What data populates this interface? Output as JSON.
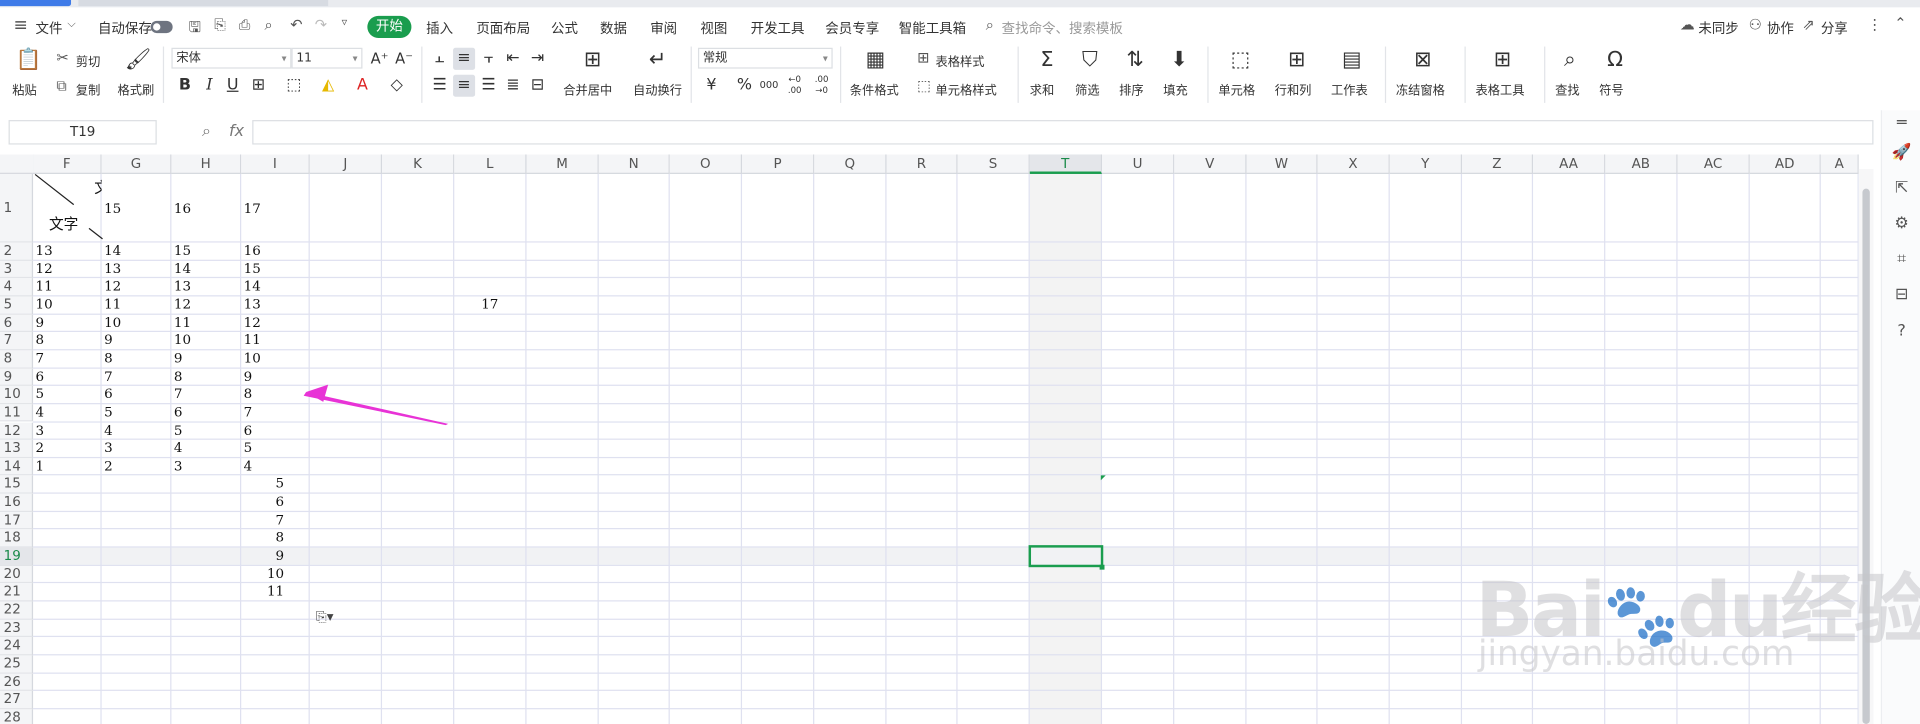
{
  "menubar": {
    "file": "文件",
    "autosave": "自动保存",
    "tabs": [
      "开始",
      "插入",
      "页面布局",
      "公式",
      "数据",
      "审阅",
      "视图",
      "开发工具",
      "会员专享",
      "智能工具箱"
    ],
    "search_placeholder": "查找命令、搜索模板",
    "sync": "未同步",
    "collab": "协作",
    "share": "分享"
  },
  "ribbon": {
    "paste": "粘贴",
    "cut": "剪切",
    "copy": "复制",
    "format_painter": "格式刷",
    "font_name": "宋体",
    "font_size": "11",
    "merge_center": "合并居中",
    "wrap_text": "自动换行",
    "number_format": "常规",
    "conditional_format": "条件格式",
    "table_style": "表格样式",
    "cell_style": "单元格样式",
    "sum": "求和",
    "filter": "筛选",
    "sort": "排序",
    "fill": "填充",
    "cell": "单元格",
    "row_col": "行和列",
    "worksheet": "工作表",
    "freeze": "冻结窗格",
    "table_tools": "表格工具",
    "find": "查找",
    "symbol": "符号",
    "yuan_symbol": "¥",
    "percent_symbol": "%",
    "thousands_symbol": "000",
    "inc_decimal": "←0 .00",
    "dec_decimal": ".00 →0"
  },
  "formula_bar": {
    "name_box": "T19",
    "fx": "fx",
    "value": ""
  },
  "grid": {
    "columns": [
      "F",
      "G",
      "H",
      "I",
      "J",
      "K",
      "L",
      "M",
      "N",
      "O",
      "P",
      "Q",
      "R",
      "S",
      "T",
      "U",
      "V",
      "W",
      "X",
      "Y",
      "Z",
      "AA",
      "AB",
      "AC",
      "AD",
      "A"
    ],
    "rows": [
      "1",
      "2",
      "3",
      "4",
      "5",
      "6",
      "7",
      "8",
      "9",
      "10",
      "11",
      "12",
      "13",
      "14",
      "15",
      "16",
      "17",
      "18",
      "19",
      "20",
      "21",
      "22",
      "23",
      "24",
      "25",
      "26",
      "27",
      "28"
    ],
    "active_column": "T",
    "active_row": "19",
    "diag_header_lower": "文字",
    "diag_header_upper": "文",
    "row1": [
      "15",
      "16",
      "17"
    ],
    "table": [
      [
        "13",
        "14",
        "15",
        "16"
      ],
      [
        "12",
        "13",
        "14",
        "15"
      ],
      [
        "11",
        "12",
        "13",
        "14"
      ],
      [
        "10",
        "11",
        "12",
        "13"
      ],
      [
        "9",
        "10",
        "11",
        "12"
      ],
      [
        "8",
        "9",
        "10",
        "11"
      ],
      [
        "7",
        "8",
        "9",
        "10"
      ],
      [
        "6",
        "7",
        "8",
        "9"
      ],
      [
        "5",
        "6",
        "7",
        "8"
      ],
      [
        "4",
        "5",
        "6",
        "7"
      ],
      [
        "3",
        "4",
        "5",
        "6"
      ],
      [
        "2",
        "3",
        "4",
        "5"
      ],
      [
        "1",
        "2",
        "3",
        "4"
      ]
    ],
    "l5_value": "17",
    "i_tail": [
      "5",
      "6",
      "7",
      "8",
      "9",
      "10",
      "11"
    ]
  },
  "watermark": {
    "line1": "Bai",
    "line1b": "du",
    "line1c": "经验",
    "line2": "jingyan.baidu.com"
  },
  "colors": {
    "accent": "#1a9d4e",
    "arrow": "#e833d6"
  }
}
